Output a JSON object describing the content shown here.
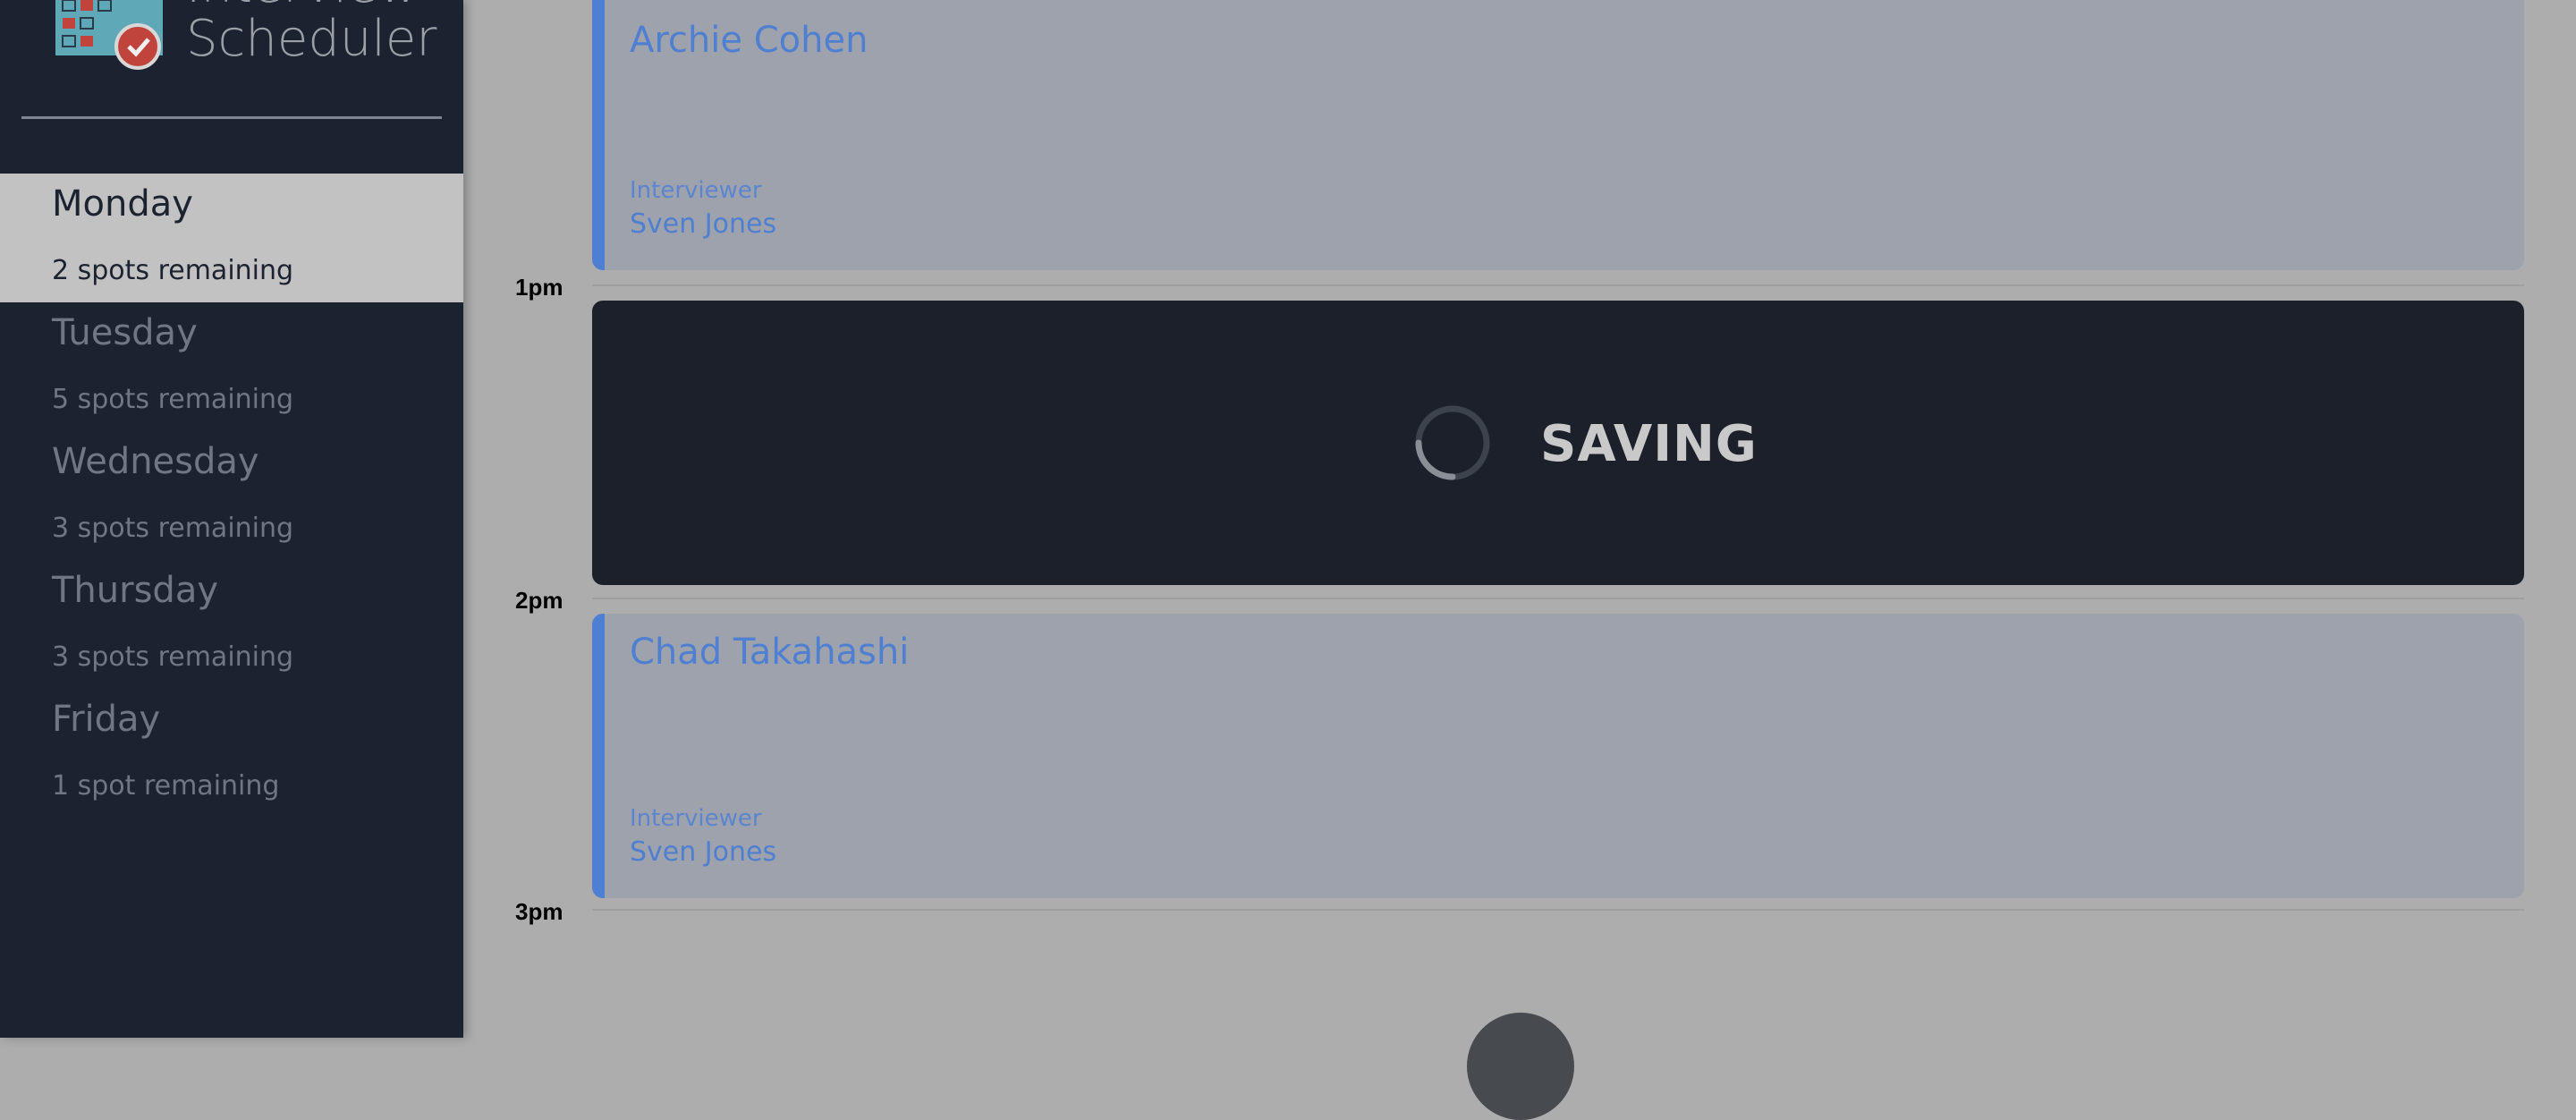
{
  "app": {
    "title_line1": "Interview",
    "title_line2": "Scheduler"
  },
  "days": [
    {
      "name": "Monday",
      "spots": "2 spots remaining",
      "selected": true
    },
    {
      "name": "Tuesday",
      "spots": "5 spots remaining",
      "selected": false
    },
    {
      "name": "Wednesday",
      "spots": "3 spots remaining",
      "selected": false
    },
    {
      "name": "Thursday",
      "spots": "3 spots remaining",
      "selected": false
    },
    {
      "name": "Friday",
      "spots": "1 spot remaining",
      "selected": false
    }
  ],
  "schedule": {
    "times": [
      "1pm",
      "2pm",
      "3pm"
    ],
    "appointments": [
      {
        "student": "Archie Cohen",
        "interviewer_label": "Interviewer",
        "interviewer": "Sven Jones"
      },
      {
        "status": "SAVING"
      },
      {
        "student": "Chad Takahashi",
        "interviewer_label": "Interviewer",
        "interviewer": "Sven Jones"
      }
    ]
  },
  "colors": {
    "sidebar_bg": "#1c2330",
    "accent": "#4f7fd1",
    "saving_bg": "#1b202a"
  },
  "icons": [
    "calendar-logo-icon",
    "spinner-icon",
    "add-icon"
  ]
}
